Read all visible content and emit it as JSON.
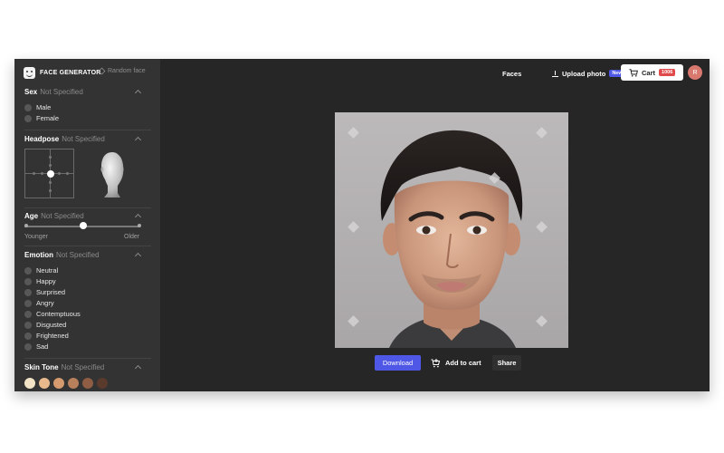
{
  "app": {
    "logo_text": "FACE GENERATOR",
    "random_face_label": "Random face"
  },
  "sidebar": {
    "sex": {
      "title": "Sex",
      "value": "Not Specified",
      "options": [
        "Male",
        "Female"
      ]
    },
    "headpose": {
      "title": "Headpose",
      "value": "Not Specified"
    },
    "age": {
      "title": "Age",
      "value": "Not Specified",
      "min_label": "Younger",
      "max_label": "Older",
      "slider_position": 0.5
    },
    "emotion": {
      "title": "Emotion",
      "value": "Not Specified",
      "options": [
        "Neutral",
        "Happy",
        "Surprised",
        "Angry",
        "Contemptuous",
        "Disgusted",
        "Frightened",
        "Sad"
      ]
    },
    "skin_tone": {
      "title": "Skin Tone",
      "value": "Not Specified",
      "swatches": [
        "#f2e2c6",
        "#e7b98c",
        "#d59a6d",
        "#b9805c",
        "#8f5d44",
        "#5a3a2c"
      ]
    }
  },
  "header": {
    "faces_label": "Faces",
    "upload_label": "Upload photo",
    "upload_badge": "New",
    "cart_label": "Cart",
    "cart_badge": "1006",
    "avatar_initial": "R"
  },
  "actions": {
    "download_label": "Download",
    "add_to_cart_label": "Add to cart",
    "share_label": "Share"
  },
  "colors": {
    "accent": "#4f57e6",
    "badge_red": "#e14a4a"
  }
}
